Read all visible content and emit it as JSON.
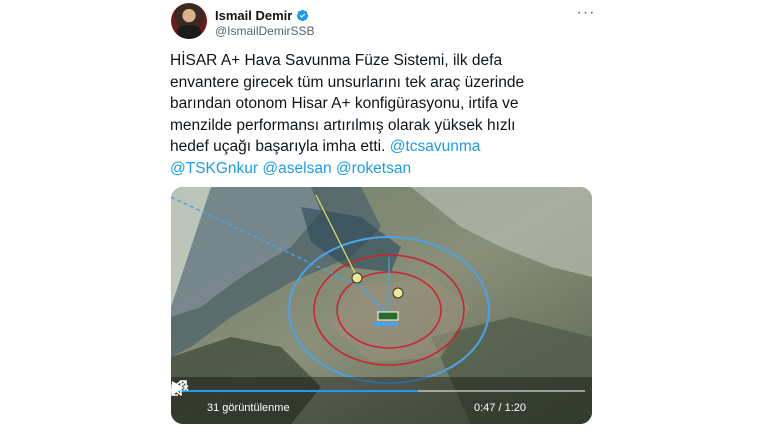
{
  "tweet": {
    "author_name": "Ismail Demir",
    "author_handle": "@IsmailDemirSSB",
    "more_label": "···",
    "text_lines": [
      "HİSAR A+ Hava Savunma Füze Sistemi, ilk defa",
      "envantere girecek tüm unsurlarını tek araç üzerinde",
      "barından otonom Hisar A+ konfigürasyonu, irtifa ve",
      "menzilde performansı artırılmış olarak yüksek hızlı"
    ],
    "line5_text": "hedef uçağı başarıyla imha etti. ",
    "mentions": [
      "@tcsavunma",
      "@TSKGnkur",
      "@aselsan",
      "@roketsan"
    ]
  },
  "video": {
    "views_label": "31 görüntülenme",
    "time_label": "0:47 / 1:20",
    "progress_fraction": 0.59
  },
  "colors": {
    "accent": "#1d9bf0",
    "text": "#0f1419",
    "secondary": "#536471"
  },
  "icons": {
    "verified": "verified-badge-icon",
    "more": "more-icon",
    "play": "play-icon",
    "volume": "volume-mute-icon",
    "fullscreen": "fullscreen-icon"
  }
}
